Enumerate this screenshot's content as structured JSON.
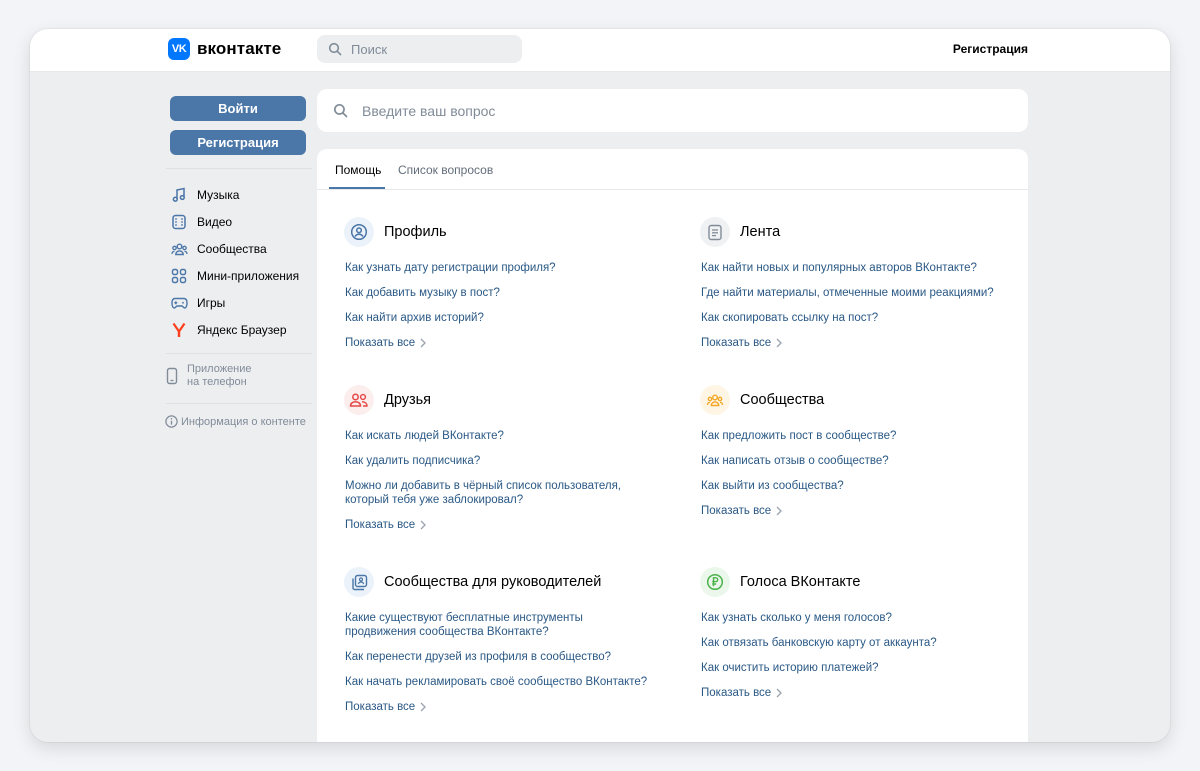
{
  "header": {
    "logo_text": "вконтакте",
    "logo_mark": "VK",
    "search_placeholder": "Поиск",
    "register_link": "Регистрация"
  },
  "sidebar": {
    "login_button": "Войти",
    "register_button": "Регистрация",
    "items": [
      {
        "label": "Музыка",
        "icon": "music-icon"
      },
      {
        "label": "Видео",
        "icon": "video-icon"
      },
      {
        "label": "Сообщества",
        "icon": "communities-icon"
      },
      {
        "label": "Мини-приложения",
        "icon": "mini-apps-icon"
      },
      {
        "label": "Игры",
        "icon": "gamepad-icon"
      },
      {
        "label": "Яндекс Браузер",
        "icon": "yandex-browser-icon"
      }
    ],
    "app_link_line1": "Приложение",
    "app_link_line2": "на телефон",
    "info_link": "Информация о контенте"
  },
  "main": {
    "search_placeholder": "Введите ваш вопрос",
    "tabs": [
      {
        "label": "Помощь",
        "active": true
      },
      {
        "label": "Список вопросов",
        "active": false
      }
    ],
    "show_all_label": "Показать все",
    "sections": [
      {
        "title": "Профиль",
        "icon": "profile-icon",
        "color": "#4a76a8",
        "questions": [
          "Как узнать дату регистрации профиля?",
          "Как добавить музыку в пост?",
          "Как найти архив историй?"
        ]
      },
      {
        "title": "Лента",
        "icon": "feed-icon",
        "color": "#818c99",
        "questions": [
          "Как найти новых и популярных авторов ВКонтакте?",
          "Где найти материалы, отмеченные моими реакциями?",
          "Как скопировать ссылку на пост?"
        ]
      },
      {
        "title": "Друзья",
        "icon": "friends-icon",
        "color": "#e64646",
        "questions": [
          "Как искать людей ВКонтакте?",
          "Как удалить подписчика?",
          "Можно ли добавить в чёрный список пользователя, который тебя уже заблокировал?"
        ]
      },
      {
        "title": "Сообщества",
        "icon": "communities-icon",
        "color": "#f5a623",
        "questions": [
          "Как предложить пост в сообществе?",
          "Как написать отзыв о сообществе?",
          "Как выйти из сообщества?"
        ]
      },
      {
        "title": "Сообщества для руководителей",
        "icon": "managers-icon",
        "color": "#4a76a8",
        "questions": [
          "Какие существуют бесплатные инструменты продвижения сообщества ВКонтакте?",
          "Как перенести друзей из профиля в сообщество?",
          "Как начать рекламировать своё сообщество ВКонтакте?"
        ]
      },
      {
        "title": "Голоса ВКонтакте",
        "icon": "ruble-coin-icon",
        "color": "#4bb34b",
        "questions": [
          "Как узнать сколько у меня голосов?",
          "Как отвязать банковскую карту от аккаунта?",
          "Как очистить историю платежей?"
        ]
      }
    ]
  }
}
